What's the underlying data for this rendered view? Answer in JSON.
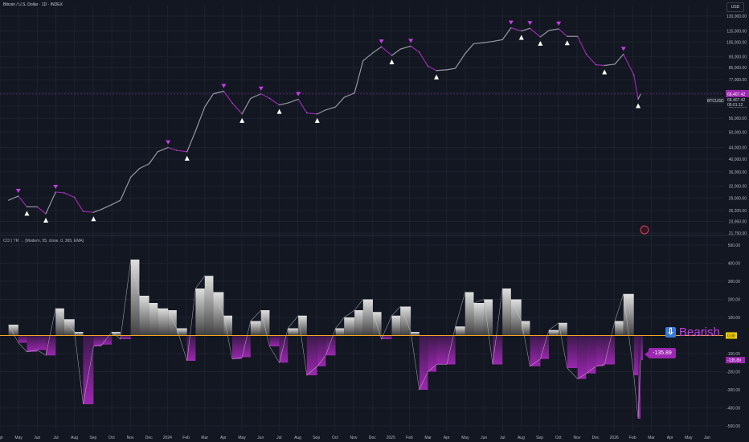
{
  "header": {
    "title": "Bitcoin / U.S. Dollar · 1D · INDEX",
    "currency": "USD"
  },
  "indicator": {
    "title": "CCI | TR → (Modern, 55, close, 0, 365, EMA)",
    "signal_label": "Bearish",
    "signal_icon": "arrow-down-icon",
    "current_value_label": "-135.89",
    "zero_label": "0.00"
  },
  "colors": {
    "background": "#131722",
    "bull": "#e0e0e0",
    "bear": "#9c27b0",
    "zero_line": "#f5a623",
    "accent": "#c63ee8"
  },
  "price_axis": {
    "labels": [
      "130,000.00",
      "115,000.00",
      "105,000.00",
      "93,000.00",
      "85,000.00",
      "77,000.00",
      "69,000.00",
      "62,000.00",
      "56,000.00",
      "50,000.00",
      "44,000.00",
      "40,000.00",
      "36,000.00",
      "32,000.00",
      "29,000.00",
      "26,200.00",
      "23,950.00",
      "21,750.00"
    ],
    "current_price_label": "68,407.42",
    "symbol_label": "BTCUSD",
    "price_tag": "68,407.42",
    "countdown": "05:01:12"
  },
  "cci_axis": {
    "labels": [
      "500.00",
      "400.00",
      "300.00",
      "200.00",
      "100.00",
      "-100.00",
      "-200.00",
      "-300.00",
      "-400.00",
      "-500.00"
    ]
  },
  "time_axis": {
    "labels": [
      "Apr",
      "May",
      "Jun",
      "Jul",
      "Aug",
      "Sep",
      "Oct",
      "Nov",
      "Dec",
      "2024",
      "Feb",
      "Mar",
      "Apr",
      "May",
      "Jun",
      "Jul",
      "Aug",
      "Sep",
      "Oct",
      "Nov",
      "Dec",
      "2025",
      "Feb",
      "Mar",
      "Apr",
      "May",
      "Jun",
      "Jul",
      "Aug",
      "Sep",
      "Oct",
      "Nov",
      "Dec",
      "2026",
      "Feb",
      "Mar",
      "Apr",
      "May",
      "Jun"
    ]
  },
  "chart_data": [
    {
      "type": "line",
      "title": "Bitcoin / U.S. Dollar · 1D · INDEX",
      "scale": "log",
      "ylim": [
        21750,
        130000
      ],
      "x": [
        "2023-04-15",
        "2023-05-01",
        "2023-05-15",
        "2023-06-01",
        "2023-06-15",
        "2023-07-01",
        "2023-07-15",
        "2023-08-01",
        "2023-08-15",
        "2023-09-01",
        "2023-09-15",
        "2023-10-01",
        "2023-10-15",
        "2023-11-01",
        "2023-11-15",
        "2023-12-01",
        "2023-12-15",
        "2024-01-01",
        "2024-01-15",
        "2024-02-01",
        "2024-02-15",
        "2024-03-01",
        "2024-03-15",
        "2024-04-01",
        "2024-04-15",
        "2024-05-01",
        "2024-05-15",
        "2024-06-01",
        "2024-06-15",
        "2024-07-01",
        "2024-07-15",
        "2024-08-01",
        "2024-08-15",
        "2024-09-01",
        "2024-09-15",
        "2024-10-01",
        "2024-10-15",
        "2024-11-01",
        "2024-11-15",
        "2024-12-01",
        "2024-12-15",
        "2025-01-01",
        "2025-01-15",
        "2025-02-01",
        "2025-02-15",
        "2025-03-01",
        "2025-03-15",
        "2025-04-01",
        "2025-04-15",
        "2025-05-01",
        "2025-05-15",
        "2025-06-01",
        "2025-06-15",
        "2025-07-01",
        "2025-07-15",
        "2025-08-01",
        "2025-08-15",
        "2025-09-01",
        "2025-09-15",
        "2025-10-01",
        "2025-10-15",
        "2025-11-01",
        "2025-11-15",
        "2025-12-01",
        "2025-12-15",
        "2026-01-01",
        "2026-01-15",
        "2026-02-01",
        "2026-02-08",
        "2026-02-12"
      ],
      "values": [
        28500,
        29500,
        27000,
        27000,
        25500,
        30500,
        30300,
        29200,
        26000,
        25800,
        26500,
        27500,
        28500,
        34500,
        37000,
        38500,
        42500,
        44000,
        43000,
        42500,
        50500,
        61500,
        68500,
        70000,
        63500,
        58000,
        66000,
        68500,
        66000,
        62500,
        63500,
        65500,
        58500,
        58000,
        60000,
        61500,
        66500,
        69000,
        90000,
        96000,
        101000,
        94000,
        99000,
        101500,
        96500,
        86000,
        83000,
        83500,
        84500,
        95500,
        103500,
        104500,
        105500,
        107000,
        118000,
        115000,
        117500,
        109500,
        115500,
        117000,
        110000,
        110000,
        95000,
        87000,
        86500,
        87500,
        95000,
        80000,
        65500,
        68400
      ],
      "markers": {
        "bullish_signals": 21,
        "bearish_signals": 26
      }
    },
    {
      "type": "area",
      "title": "CCI | TR → (Modern, 55, close, 0, 365, EMA)",
      "ylim": [
        -500,
        500
      ],
      "x": [
        "2023-04-15",
        "2023-05-01",
        "2023-05-15",
        "2023-06-01",
        "2023-06-15",
        "2023-07-01",
        "2023-07-15",
        "2023-08-01",
        "2023-08-15",
        "2023-09-01",
        "2023-09-15",
        "2023-10-01",
        "2023-10-15",
        "2023-11-01",
        "2023-11-15",
        "2023-12-01",
        "2023-12-15",
        "2024-01-01",
        "2024-01-15",
        "2024-02-01",
        "2024-02-15",
        "2024-03-01",
        "2024-03-15",
        "2024-04-01",
        "2024-04-15",
        "2024-05-01",
        "2024-05-15",
        "2024-06-01",
        "2024-06-15",
        "2024-07-01",
        "2024-07-15",
        "2024-08-01",
        "2024-08-15",
        "2024-09-01",
        "2024-09-15",
        "2024-10-01",
        "2024-10-15",
        "2024-11-01",
        "2024-11-15",
        "2024-12-01",
        "2024-12-15",
        "2025-01-01",
        "2025-01-15",
        "2025-02-01",
        "2025-02-15",
        "2025-03-01",
        "2025-03-15",
        "2025-04-01",
        "2025-04-15",
        "2025-05-01",
        "2025-05-15",
        "2025-06-01",
        "2025-06-15",
        "2025-07-01",
        "2025-07-15",
        "2025-08-01",
        "2025-08-15",
        "2025-09-01",
        "2025-09-15",
        "2025-10-01",
        "2025-10-15",
        "2025-11-01",
        "2025-11-15",
        "2025-12-01",
        "2025-12-15",
        "2026-01-01",
        "2026-01-15",
        "2026-02-01",
        "2026-02-08",
        "2026-02-12"
      ],
      "values": [
        60,
        -40,
        -90,
        -80,
        -110,
        150,
        90,
        20,
        -380,
        -60,
        -50,
        20,
        -20,
        420,
        220,
        180,
        150,
        140,
        40,
        -140,
        260,
        330,
        240,
        110,
        -130,
        -120,
        80,
        140,
        -60,
        -150,
        40,
        110,
        -220,
        -170,
        -110,
        40,
        100,
        140,
        200,
        130,
        -20,
        110,
        160,
        20,
        -300,
        -200,
        -160,
        -160,
        50,
        240,
        180,
        200,
        -160,
        260,
        200,
        80,
        -170,
        -130,
        30,
        70,
        -180,
        -240,
        -210,
        -170,
        -160,
        80,
        230,
        -220,
        -460,
        -136
      ]
    }
  ]
}
